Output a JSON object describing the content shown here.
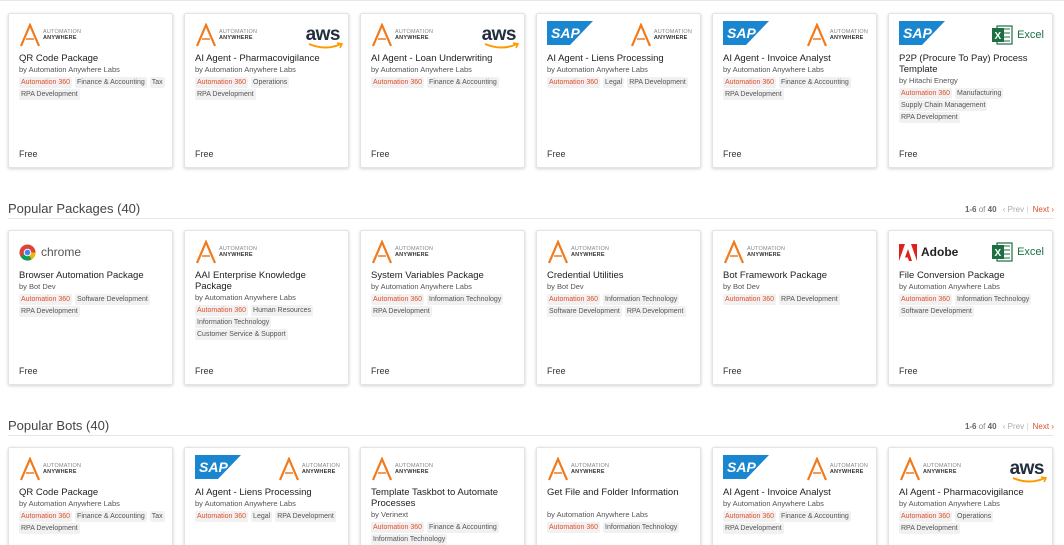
{
  "sections": [
    {
      "title": "",
      "cards": [
        {
          "logos": [
            "aa"
          ],
          "title": "QR Code Package",
          "by": "by Automation Anywhere Labs",
          "tags": [
            [
              "Automation 360",
              "o"
            ],
            [
              "Finance & Accounting",
              ""
            ],
            [
              "Tax",
              ""
            ],
            [
              "RPA Development",
              ""
            ]
          ],
          "price": "Free"
        },
        {
          "logos": [
            "aa",
            "aws"
          ],
          "title": "AI Agent - Pharmacovigilance",
          "by": "by Automation Anywhere Labs",
          "tags": [
            [
              "Automation 360",
              "o"
            ],
            [
              "Operations",
              ""
            ],
            [
              "RPA Development",
              ""
            ]
          ],
          "price": "Free"
        },
        {
          "logos": [
            "aa",
            "aws"
          ],
          "title": "AI Agent - Loan Underwriting",
          "by": "by Automation Anywhere Labs",
          "tags": [
            [
              "Automation 360",
              "o"
            ],
            [
              "Finance & Accounting",
              ""
            ]
          ],
          "price": "Free"
        },
        {
          "logos": [
            "sap",
            "aa"
          ],
          "title": "AI Agent - Liens Processing",
          "by": "by Automation Anywhere Labs",
          "tags": [
            [
              "Automation 360",
              "o"
            ],
            [
              "Legal",
              ""
            ],
            [
              "RPA Development",
              ""
            ]
          ],
          "price": "Free"
        },
        {
          "logos": [
            "sap",
            "aa"
          ],
          "title": "AI Agent - Invoice Analyst",
          "by": "by Automation Anywhere Labs",
          "tags": [
            [
              "Automation 360",
              "o"
            ],
            [
              "Finance & Accounting",
              ""
            ],
            [
              "RPA Development",
              ""
            ]
          ],
          "price": "Free"
        },
        {
          "logos": [
            "sap",
            "excel"
          ],
          "title": "P2P (Procure To Pay) Process Template",
          "by": "by Hitachi Energy",
          "tags": [
            [
              "Automation 360",
              "o"
            ],
            [
              "Manufacturing",
              ""
            ],
            [
              "Supply Chain Management",
              ""
            ],
            [
              "RPA Development",
              ""
            ]
          ],
          "price": "Free"
        }
      ]
    },
    {
      "title": "Popular Packages (40)",
      "pager": {
        "range": "1-6",
        "of": "of",
        "total": "40",
        "prev": "‹ Prev",
        "next": "Next ›"
      },
      "cards": [
        {
          "logos": [
            "chrome"
          ],
          "title": "Browser Automation Package",
          "by": "by Bot Dev",
          "tags": [
            [
              "Automation 360",
              "o"
            ],
            [
              "Software Development",
              ""
            ],
            [
              "RPA Development",
              ""
            ]
          ],
          "price": "Free"
        },
        {
          "logos": [
            "aa"
          ],
          "title": "AAI Enterprise Knowledge Package",
          "by": "by Automation Anywhere Labs",
          "tags": [
            [
              "Automation 360",
              "o"
            ],
            [
              "Human Resources",
              ""
            ],
            [
              "Information Technology",
              ""
            ],
            [
              "Customer Service & Support",
              ""
            ]
          ],
          "price": "Free"
        },
        {
          "logos": [
            "aa"
          ],
          "title": "System Variables Package",
          "by": "by Automation Anywhere Labs",
          "tags": [
            [
              "Automation 360",
              "o"
            ],
            [
              "Information Technology",
              ""
            ],
            [
              "RPA Development",
              ""
            ]
          ],
          "price": "Free"
        },
        {
          "logos": [
            "aa"
          ],
          "title": "Credential Utilities",
          "by": "by Bot Dev",
          "tags": [
            [
              "Automation 360",
              "o"
            ],
            [
              "Information Technology",
              ""
            ],
            [
              "Software Development",
              ""
            ],
            [
              "RPA Development",
              ""
            ]
          ],
          "price": "Free"
        },
        {
          "logos": [
            "aa"
          ],
          "title": "Bot Framework Package",
          "by": "by Bot Dev",
          "tags": [
            [
              "Automation 360",
              "o"
            ],
            [
              "RPA Development",
              ""
            ]
          ],
          "price": "Free"
        },
        {
          "logos": [
            "adobe",
            "excel"
          ],
          "title": "File Conversion Package",
          "by": "by Automation Anywhere Labs",
          "tags": [
            [
              "Automation 360",
              "o"
            ],
            [
              "Information Technology",
              ""
            ],
            [
              "Software Development",
              ""
            ]
          ],
          "price": "Free"
        }
      ]
    },
    {
      "title": "Popular Bots (40)",
      "pager": {
        "range": "1-6",
        "of": "of",
        "total": "40",
        "prev": "‹ Prev",
        "next": "Next ›"
      },
      "cards": [
        {
          "logos": [
            "aa"
          ],
          "title": "QR Code Package",
          "by": "by Automation Anywhere Labs",
          "tags": [
            [
              "Automation 360",
              "o"
            ],
            [
              "Finance & Accounting",
              ""
            ],
            [
              "Tax",
              ""
            ],
            [
              "RPA Development",
              ""
            ]
          ],
          "price": ""
        },
        {
          "logos": [
            "sap",
            "aa"
          ],
          "title": "AI Agent - Liens Processing",
          "by": "by Automation Anywhere Labs",
          "tags": [
            [
              "Automation 360",
              "o"
            ],
            [
              "Legal",
              ""
            ],
            [
              "RPA Development",
              ""
            ]
          ],
          "price": ""
        },
        {
          "logos": [
            "aa"
          ],
          "title": "Template Taskbot to Automate Processes",
          "by": "by Verinext",
          "tags": [
            [
              "Automation 360",
              "o"
            ],
            [
              "Finance & Accounting",
              ""
            ],
            [
              "Information Technology",
              ""
            ]
          ],
          "price": ""
        },
        {
          "logos": [
            "aa"
          ],
          "title": "Get File and Folder Information",
          "by": "by Automation Anywhere Labs",
          "tags": [
            [
              "Automation 360",
              "o"
            ],
            [
              "Information Technology",
              ""
            ]
          ],
          "price": ""
        },
        {
          "logos": [
            "sap",
            "aa"
          ],
          "title": "AI Agent - Invoice Analyst",
          "by": "by Automation Anywhere Labs",
          "tags": [
            [
              "Automation 360",
              "o"
            ],
            [
              "Finance & Accounting",
              ""
            ],
            [
              "RPA Development",
              ""
            ]
          ],
          "price": ""
        },
        {
          "logos": [
            "aa",
            "aws"
          ],
          "title": "AI Agent - Pharmacovigilance",
          "by": "by Automation Anywhere Labs",
          "tags": [
            [
              "Automation 360",
              "o"
            ],
            [
              "Operations",
              ""
            ],
            [
              "RPA Development",
              ""
            ]
          ],
          "price": ""
        }
      ]
    }
  ],
  "logo_text": {
    "aa_line1": "AUTOMATION",
    "aa_line2": "ANYWHERE",
    "aws": "aws",
    "sap": "SAP",
    "excel": "Excel",
    "chrome": "chrome",
    "adobe": "Adobe"
  },
  "colors": {
    "accent": "#e0502a",
    "aa_orange": "#f07a1e",
    "sap_blue": "#1a86d0",
    "aws_orange": "#ff9900",
    "excel_green": "#1d6f42",
    "adobe_red": "#e0201b"
  }
}
